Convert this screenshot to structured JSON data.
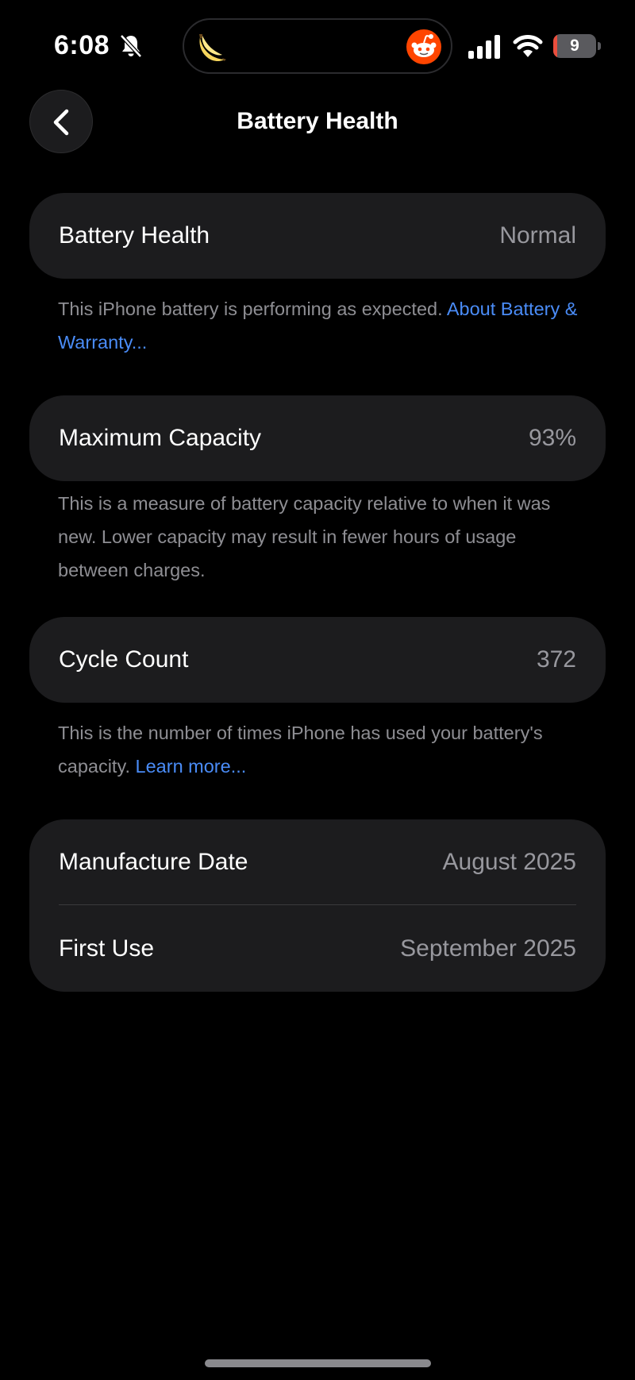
{
  "status_bar": {
    "time": "6:08",
    "battery_level": "9",
    "battery_fraction": 0.09,
    "icons": [
      "bell-slash-icon",
      "banana-icon",
      "reddit-icon",
      "cellular-signal-icon",
      "wifi-icon",
      "battery-icon"
    ]
  },
  "nav": {
    "title": "Battery Health",
    "back_icon": "chevron-left-icon"
  },
  "battery_health": {
    "label": "Battery Health",
    "value": "Normal",
    "description": "This iPhone battery is performing as expected. ",
    "link_text": "About Battery & Warranty..."
  },
  "maximum_capacity": {
    "label": "Maximum Capacity",
    "value": "93%",
    "description": "This is a measure of battery capacity relative to when it was new. Lower capacity may result in fewer hours of usage between charges."
  },
  "cycle_count": {
    "label": "Cycle Count",
    "value": "372",
    "description": "This is the number of times iPhone has used your battery's capacity. ",
    "link_text": "Learn more..."
  },
  "dates": {
    "manufacture_label": "Manufacture Date",
    "manufacture_value": "August 2025",
    "first_use_label": "First Use",
    "first_use_value": "September 2025"
  },
  "colors": {
    "background": "#000000",
    "card": "#1c1c1e",
    "secondary_text": "#98989e",
    "link": "#4a8cf7",
    "battery_low": "#eb4e3d"
  }
}
